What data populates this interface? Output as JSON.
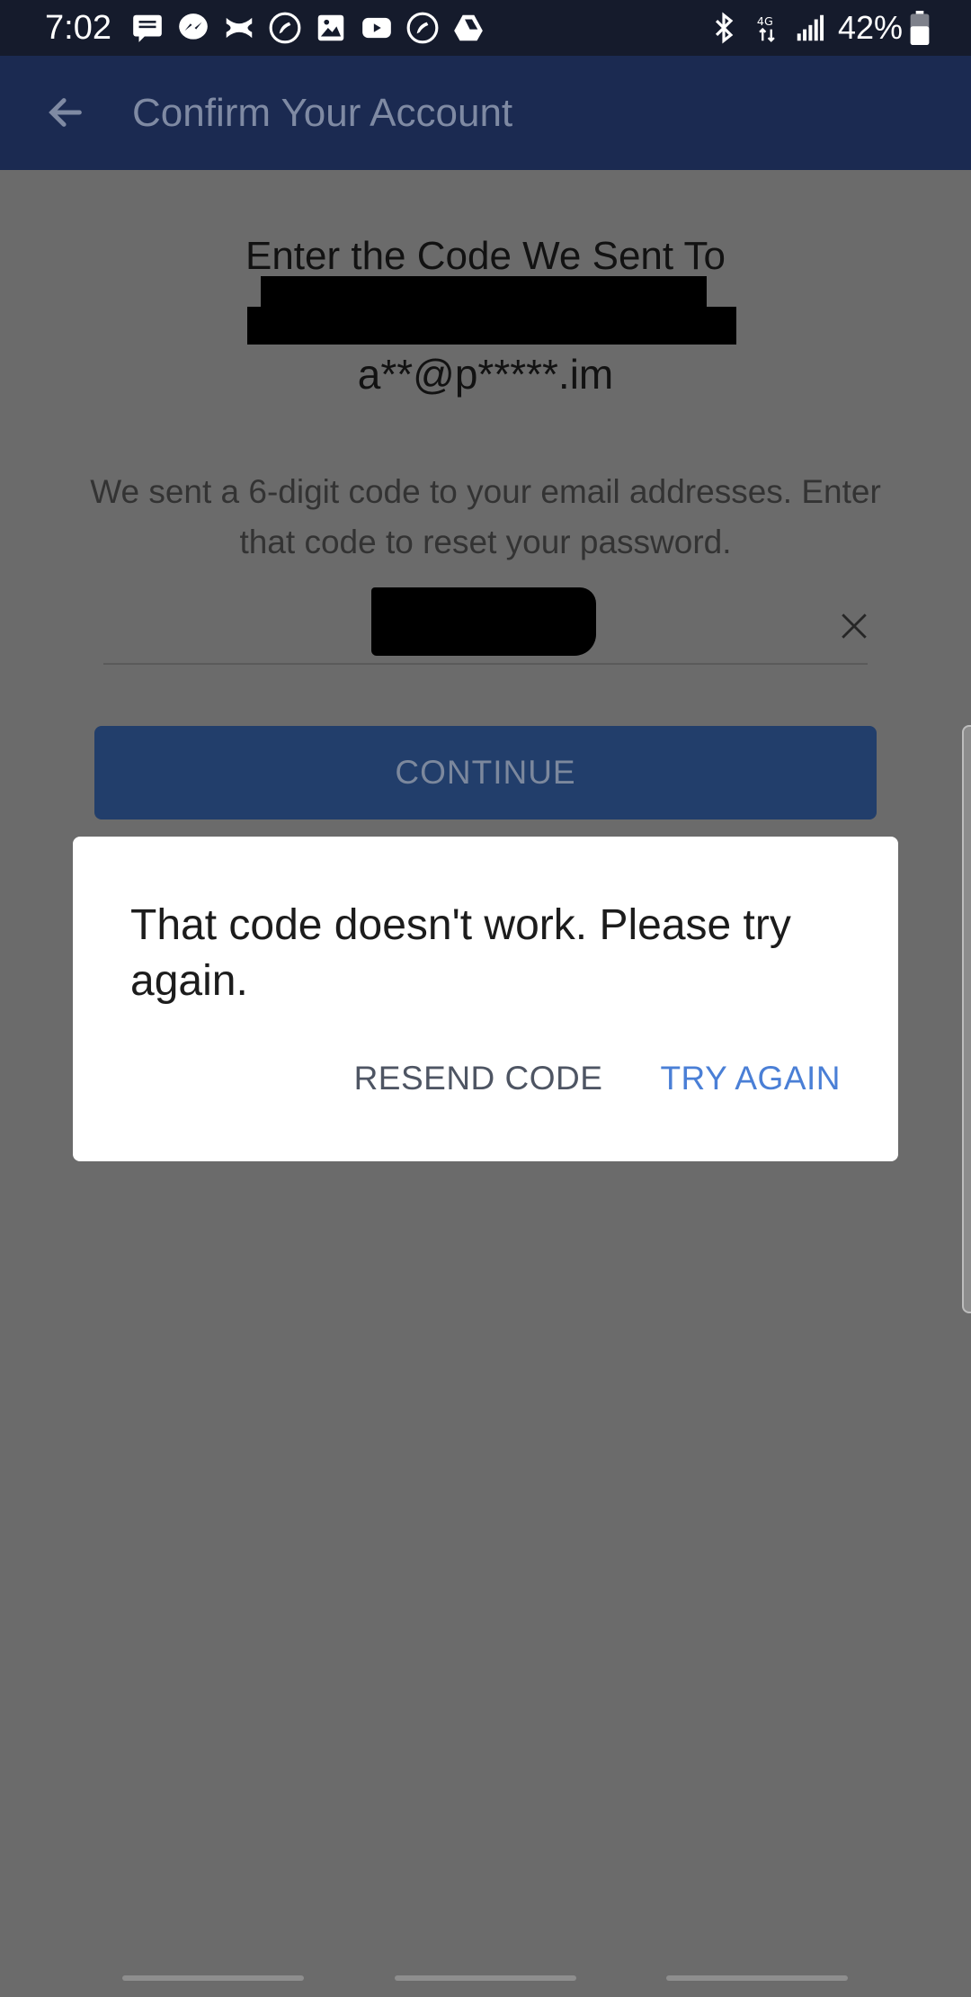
{
  "status_bar": {
    "time": "7:02",
    "battery_text": "42%",
    "icons": [
      "message-icon",
      "messenger-icon",
      "bow-app-icon",
      "phone-icon",
      "gallery-icon",
      "youtube-icon",
      "phone-icon",
      "drive-icon",
      "bluetooth-icon",
      "4g-lte-icon",
      "signal-icon",
      "battery-icon"
    ]
  },
  "app_bar": {
    "title": "Confirm Your Account",
    "back_icon": "arrow-left-icon"
  },
  "content": {
    "heading": "Enter the Code We Sent To",
    "masked_email": "a**@p*****.im",
    "instructions": "We sent a 6-digit code to your email addresses. Enter that code to reset your password.",
    "code_input": {
      "value": "",
      "placeholder": ""
    },
    "continue_label": "CONTINUE"
  },
  "dialog": {
    "message": "That code doesn't work. Please try again.",
    "resend_label": "RESEND CODE",
    "try_again_label": "TRY AGAIN"
  },
  "colors": {
    "status_bar": "#151b2c",
    "app_bar": "#1b2a51",
    "overlay": "#6b6b6b",
    "continue_button": "#223e6b",
    "accent_link": "#4a7fd6"
  }
}
